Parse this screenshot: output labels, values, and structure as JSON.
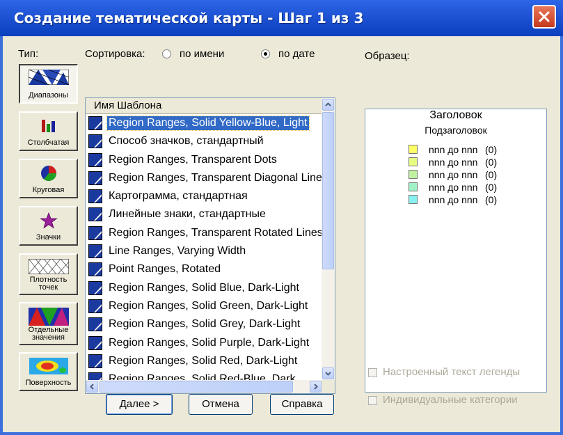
{
  "window": {
    "title": "Создание тематической карты - Шаг 1 из 3"
  },
  "type_label": "Тип:",
  "types": [
    {
      "label": "Диапазоны",
      "icon": "ranges-icon",
      "active": true
    },
    {
      "label": "Столбчатая",
      "icon": "bar-chart-icon"
    },
    {
      "label": "Круговая",
      "icon": "pie-chart-icon"
    },
    {
      "label": "Значки",
      "icon": "star-icon"
    },
    {
      "label": "Плотность точек",
      "icon": "dot-density-icon"
    },
    {
      "label": "Отдельные значения",
      "icon": "individual-values-icon"
    },
    {
      "label": "Поверхность",
      "icon": "surface-icon"
    }
  ],
  "sort": {
    "label": "Сортировка:",
    "by_name": "по имени",
    "by_date": "по дате",
    "selected": "by_date"
  },
  "template_list": {
    "header": "Имя Шаблона",
    "items": [
      "Region Ranges, Solid Yellow-Blue, Light",
      "Способ значков, стандартный",
      "Region Ranges, Transparent Dots",
      "Region Ranges, Transparent Diagonal Lines",
      "Картограмма, стандартная",
      "Линейные знаки, стандартные",
      "Region Ranges, Transparent Rotated Lines",
      "Line Ranges, Varying Width",
      "Point Ranges, Rotated",
      "Region Ranges, Solid Blue, Dark-Light",
      "Region Ranges, Solid Green, Dark-Light",
      "Region Ranges, Solid Grey, Dark-Light",
      "Region Ranges, Solid Purple, Dark-Light",
      "Region Ranges, Solid Red, Dark-Light",
      "Region Ranges, Solid Red-Blue, Dark"
    ],
    "selected_index": 0
  },
  "preview": {
    "label": "Образец:",
    "title": "Заголовок",
    "subtitle": "Подзаголовок",
    "legend": [
      {
        "text": "nnn до nnn",
        "count": "(0)",
        "color": "#ffff66"
      },
      {
        "text": "nnn до nnn",
        "count": "(0)",
        "color": "#e6ff80"
      },
      {
        "text": "nnn до nnn",
        "count": "(0)",
        "color": "#c0f0a0"
      },
      {
        "text": "nnn до nnn",
        "count": "(0)",
        "color": "#a0f0c8"
      },
      {
        "text": "nnn до nnn",
        "count": "(0)",
        "color": "#88f0f0"
      }
    ]
  },
  "options": {
    "custom_legend": "Настроенный текст легенды",
    "individual_categories": "Индивидуальные категории"
  },
  "buttons": {
    "next": "Далее >",
    "cancel": "Отмена",
    "help": "Справка"
  }
}
